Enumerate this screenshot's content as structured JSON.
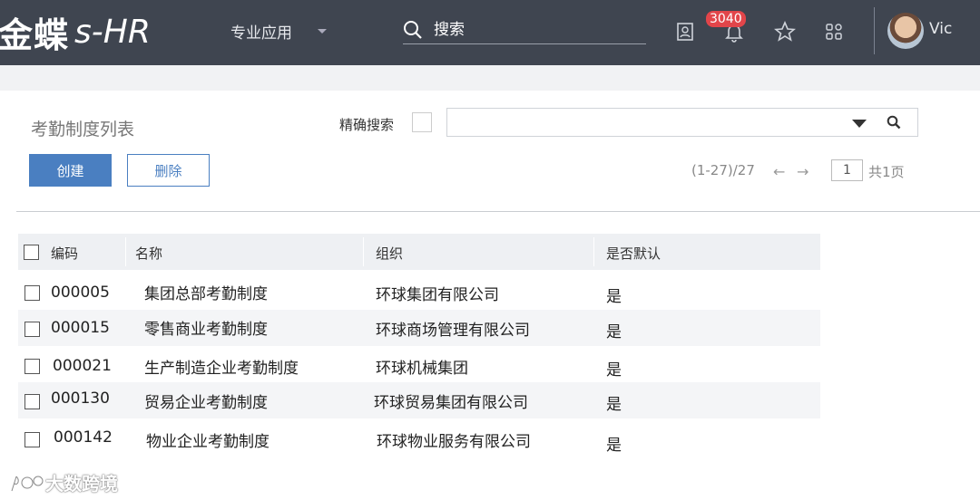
{
  "header": {
    "logo_cn": "金蝶",
    "logo_en": "s-HR",
    "menu_label": "专业应用",
    "search_placeholder": "搜索",
    "notification_count": "3040",
    "username": "Vic"
  },
  "page": {
    "title": "考勤制度列表",
    "exact_search_label": "精确搜索",
    "create_label": "创建",
    "delete_label": "删除",
    "range_text": "(1-27)/27",
    "prev_arrow": "←",
    "next_arrow": "→",
    "current_page": "1",
    "total_pages_text": "共1页"
  },
  "table": {
    "columns": [
      "编码",
      "名称",
      "组织",
      "是否默认"
    ],
    "rows": [
      {
        "code": "000005",
        "name": "集团总部考勤制度",
        "org": "环球集团有限公司",
        "default": "是"
      },
      {
        "code": "000015",
        "name": "零售商业考勤制度",
        "org": "环球商场管理有限公司",
        "default": "是"
      },
      {
        "code": "000021",
        "name": "生产制造企业考勤制度",
        "org": "环球机械集团",
        "default": "是"
      },
      {
        "code": "000130",
        "name": "贸易企业考勤制度",
        "org": "环球贸易集团有限公司",
        "default": "是"
      },
      {
        "code": "000142",
        "name": "物业企业考勤制度",
        "org": "环球物业服务有限公司",
        "default": "是"
      }
    ]
  },
  "watermark": "大数跨境",
  "icons": {
    "contacts": "contacts-icon",
    "bell": "bell-icon",
    "star": "star-icon",
    "apps": "apps-grid-icon",
    "search": "search-icon",
    "dropdown": "dropdown-icon"
  },
  "colors": {
    "topbar": "#3f4550",
    "primary": "#4a7fc1",
    "badge": "#e2454a",
    "header_row": "#eef0f3"
  }
}
